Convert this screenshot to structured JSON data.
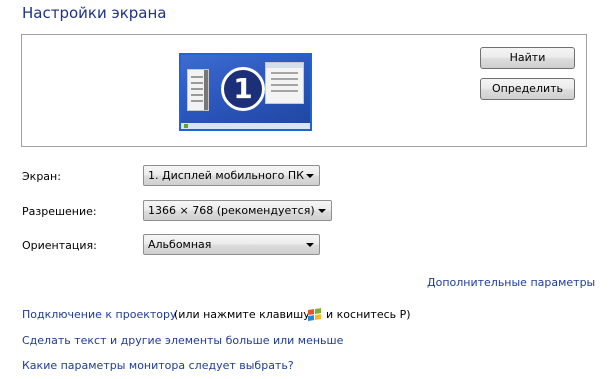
{
  "page": {
    "title": "Настройки экрана"
  },
  "monitor_panel": {
    "monitor_number": "1",
    "find_button": "Найти",
    "identify_button": "Определить"
  },
  "settings": {
    "display": {
      "label": "Экран:",
      "value": "1. Дисплей мобильного ПК"
    },
    "resolution": {
      "label": "Разрешение:",
      "value": "1366 × 768 (рекомендуется)"
    },
    "orientation": {
      "label": "Ориентация:",
      "value": "Альбомная"
    }
  },
  "links": {
    "advanced": "Дополнительные параметры",
    "projector": "Подключение к проектору",
    "projector_hint_before": "(или нажмите клавишу",
    "projector_hint_after": "и коснитесь P)",
    "text_size": "Сделать текст и другие элементы больше или меньше",
    "which_settings": "Какие параметры монитора следует выбрать?"
  },
  "icons": {
    "windows_key": "windows-logo-icon",
    "dropdown_arrow": "chevron-down-icon"
  },
  "colors": {
    "title": "#1e3287",
    "link": "#1e3c96",
    "monitor_border": "#1e64d2",
    "monitor_badge": "#1c2f79",
    "win_red": "#e8532b",
    "win_green": "#7cb32b",
    "win_blue": "#1f8ddd",
    "win_yellow": "#f7b92d"
  }
}
